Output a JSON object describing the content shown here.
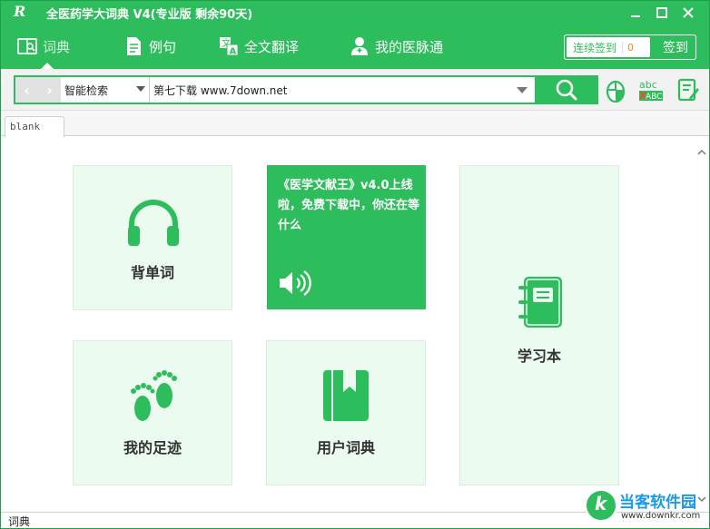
{
  "window": {
    "logo": "R",
    "title": "全医药学大词典  V4(专业版 剩余90天)"
  },
  "nav": {
    "items": [
      {
        "label": "词典"
      },
      {
        "label": "例句"
      },
      {
        "label": "全文翻译"
      },
      {
        "label": "我的医脉通"
      }
    ],
    "sign_in_streak_label": "连续签到",
    "sign_in_count": "0",
    "sign_in_button": "签到"
  },
  "search": {
    "mode": "智能检索",
    "query": "第七下载 www.7down.net"
  },
  "tabs": [
    {
      "label": "blank"
    }
  ],
  "cards": {
    "vocab": "背单词",
    "promo": "《医学文献王》v4.0上线啦，免费下载中，你还在等什么",
    "notebook": "学习本",
    "footprints": "我的足迹",
    "user_dict": "用户词典"
  },
  "status": {
    "text": "词典"
  },
  "watermark": {
    "title": "当客软件园",
    "url": "www.downkr.com"
  },
  "colors": {
    "brand": "#2ebd5c",
    "card_bg": "#ecfbf0"
  }
}
